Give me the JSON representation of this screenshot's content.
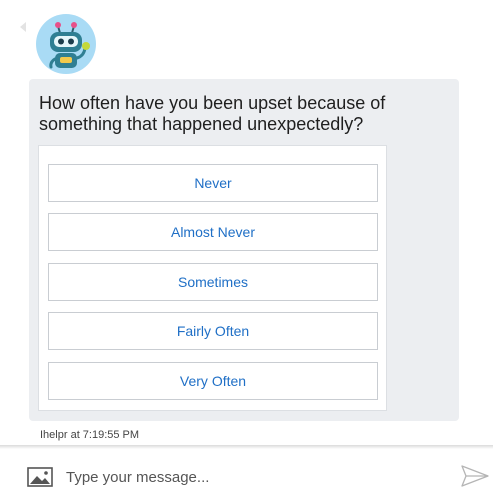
{
  "chat": {
    "question": "How often have you been upset because of something that happened unexpectedly?",
    "options": [
      {
        "label": "Never"
      },
      {
        "label": "Almost Never"
      },
      {
        "label": "Sometimes"
      },
      {
        "label": "Fairly Often"
      },
      {
        "label": "Very Often"
      }
    ],
    "timestamp": "Ihelpr at 7:19:55 PM"
  },
  "composer": {
    "placeholder": "Type your message..."
  },
  "icons": {
    "avatar": "robot-avatar-icon",
    "attach": "image-icon",
    "send": "send-icon",
    "collapse": "chevron-left-icon"
  },
  "colors": {
    "option_text": "#1f6fc6",
    "bubble_bg": "#eceef1",
    "avatar_bg": "#a9dbf5"
  }
}
